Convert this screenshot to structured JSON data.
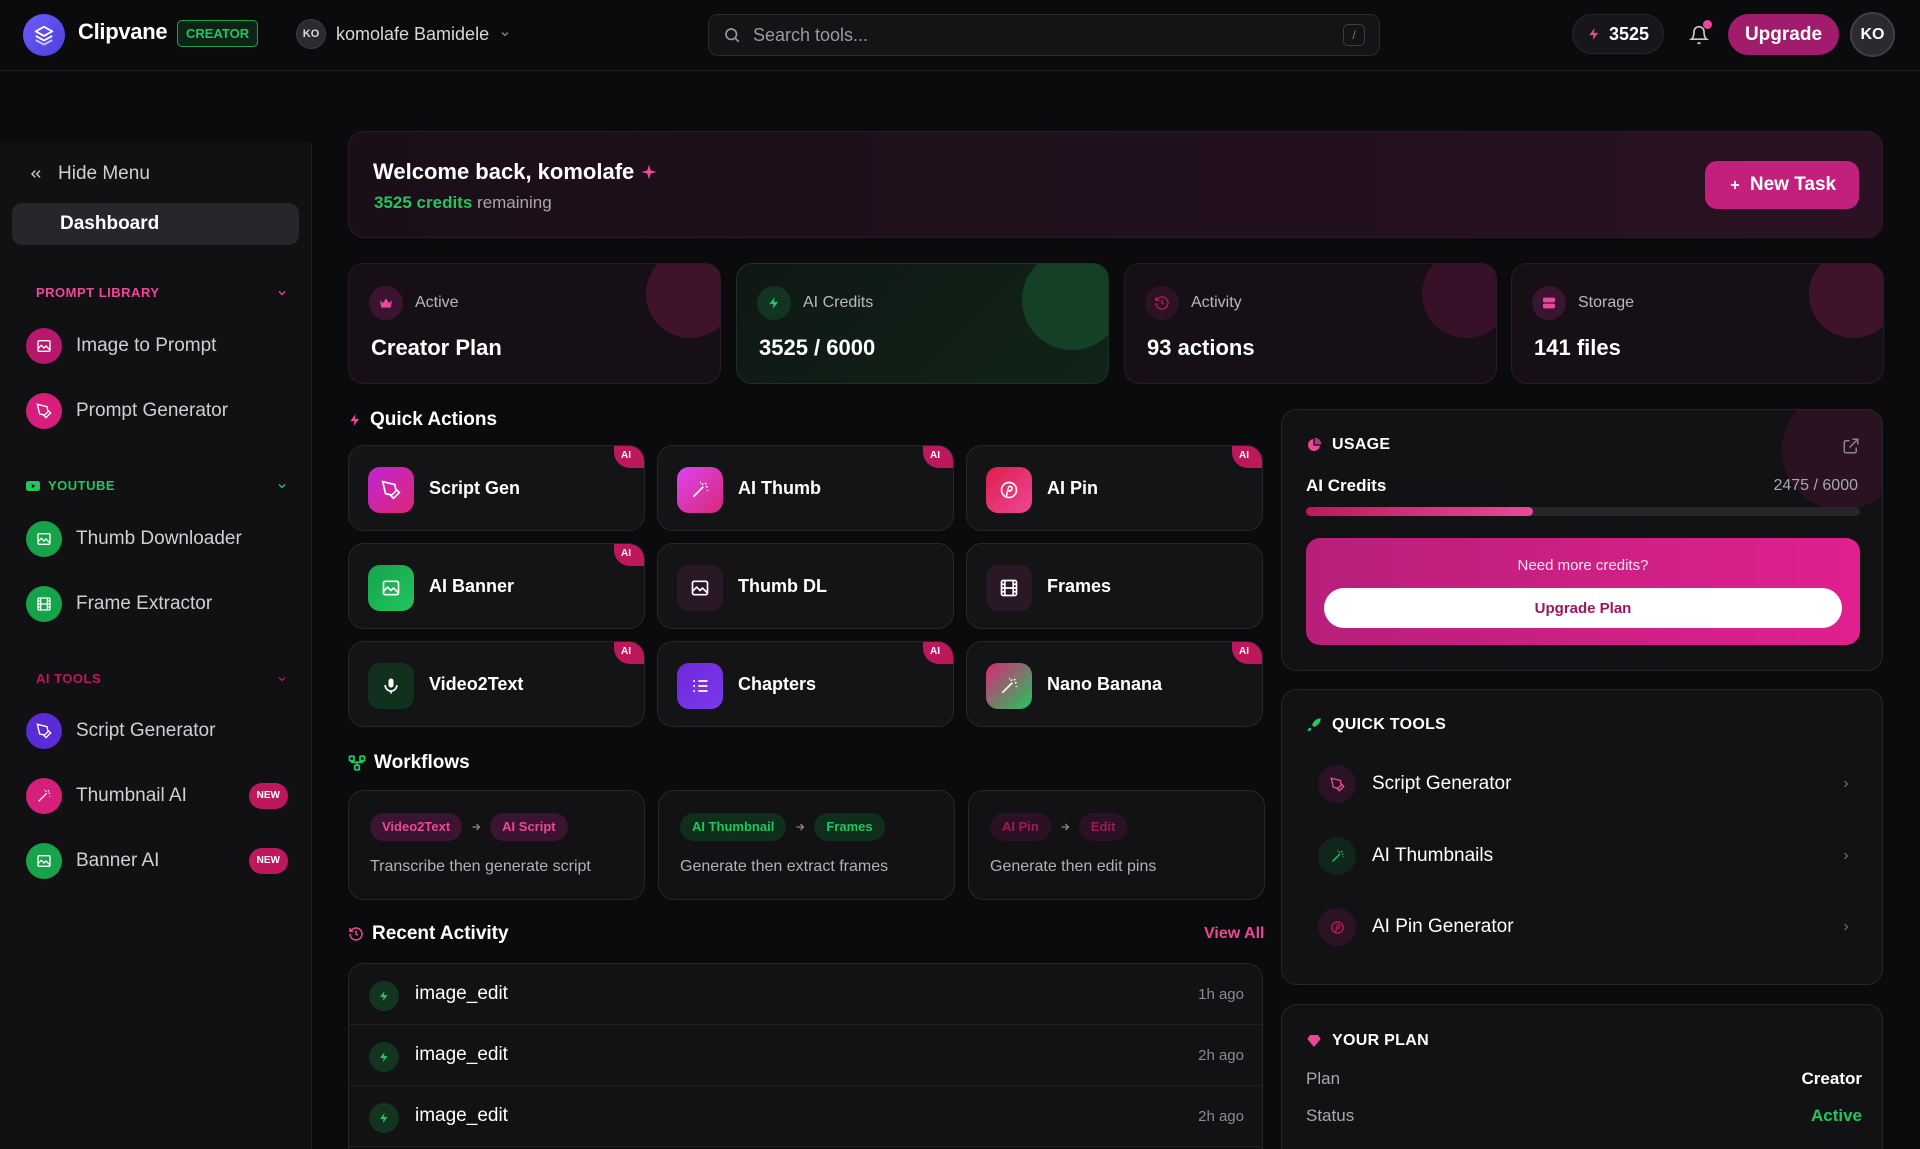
{
  "header": {
    "brand": "Clipvane",
    "badge": "CREATOR",
    "user_initials": "KO",
    "user_name": "komolafe Bamidele",
    "search_placeholder": "Search tools...",
    "search_shortcut": "/",
    "credits": "3525",
    "upgrade_label": "Upgrade",
    "avatar_initials": "KO"
  },
  "sidebar": {
    "hide_menu": "Hide Menu",
    "active_item": "Dashboard",
    "sections": [
      {
        "title": "PROMPT LIBRARY",
        "color": "#ec4899",
        "items": [
          {
            "label": "Image to Prompt",
            "badge": ""
          },
          {
            "label": "Prompt Generator",
            "badge": ""
          }
        ]
      },
      {
        "title": "YOUTUBE",
        "color": "#22c55e",
        "items": [
          {
            "label": "Thumb Downloader",
            "badge": ""
          },
          {
            "label": "Frame Extractor",
            "badge": ""
          }
        ]
      },
      {
        "title": "AI TOOLS",
        "color": "#be185d",
        "items": [
          {
            "label": "Script Generator",
            "badge": ""
          },
          {
            "label": "Thumbnail AI",
            "badge": "NEW"
          },
          {
            "label": "Banner AI",
            "badge": "NEW"
          }
        ]
      }
    ]
  },
  "welcome": {
    "title": "Welcome back, komolafe",
    "credits_text": "3525 credits",
    "remaining_text": "remaining",
    "new_task": "New Task"
  },
  "stats": [
    {
      "label": "Active",
      "value": "Creator Plan"
    },
    {
      "label": "AI Credits",
      "value": "3525 / 6000"
    },
    {
      "label": "Activity",
      "value": "93 actions"
    },
    {
      "label": "Storage",
      "value": "141 files"
    }
  ],
  "quick_actions": {
    "title": "Quick Actions",
    "items": [
      {
        "label": "Script Gen",
        "badge": "AI"
      },
      {
        "label": "AI Thumb",
        "badge": "AI"
      },
      {
        "label": "AI Pin",
        "badge": "AI"
      },
      {
        "label": "AI Banner",
        "badge": "AI"
      },
      {
        "label": "Thumb DL",
        "badge": ""
      },
      {
        "label": "Frames",
        "badge": ""
      },
      {
        "label": "Video2Text",
        "badge": "AI"
      },
      {
        "label": "Chapters",
        "badge": "AI"
      },
      {
        "label": "Nano Banana",
        "badge": "AI"
      }
    ]
  },
  "workflows": {
    "title": "Workflows",
    "items": [
      {
        "from": "Video2Text",
        "to": "AI Script",
        "desc": "Transcribe then generate script"
      },
      {
        "from": "AI Thumbnail",
        "to": "Frames",
        "desc": "Generate then extract frames"
      },
      {
        "from": "AI Pin",
        "to": "Edit",
        "desc": "Generate then edit pins"
      }
    ]
  },
  "recent_activity": {
    "title": "Recent Activity",
    "view_all": "View All",
    "items": [
      {
        "name": "image_edit",
        "time": "1h ago"
      },
      {
        "name": "image_edit",
        "time": "2h ago"
      },
      {
        "name": "image_edit",
        "time": "2h ago"
      }
    ]
  },
  "usage": {
    "title": "USAGE",
    "label": "AI Credits",
    "value": "2475 / 6000",
    "progress": 0.41,
    "need_more": "Need more credits?",
    "upgrade_plan": "Upgrade Plan"
  },
  "quick_tools": {
    "title": "QUICK TOOLS",
    "items": [
      {
        "label": "Script Generator"
      },
      {
        "label": "AI Thumbnails"
      },
      {
        "label": "AI Pin Generator"
      }
    ]
  },
  "your_plan": {
    "title": "YOUR PLAN",
    "plan_label": "Plan",
    "plan_value": "Creator",
    "status_label": "Status",
    "status_value": "Active"
  },
  "colors": {
    "accent": "#ec4899",
    "green": "#22c55e",
    "background": "#0b0b0d"
  }
}
